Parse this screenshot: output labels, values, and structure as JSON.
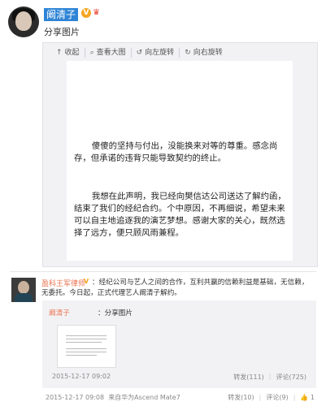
{
  "header": {
    "username": "阚清子",
    "share_text": "分享图片"
  },
  "viewer": {
    "toolbar": [
      {
        "icon": "arrow-up-icon",
        "label": "收起"
      },
      {
        "icon": "magnifier-icon",
        "label": "查看大图"
      },
      {
        "icon": "rotate-left-icon",
        "label": "向左旋转"
      },
      {
        "icon": "rotate-right-icon",
        "label": "向右旋转"
      }
    ],
    "paragraph1": "傻傻的坚持与付出，没能换来对等的尊重。感念尚存，但承诺的违背只能导致契约的终止。",
    "paragraph2": "我想在此声明，我已经向樊信达公司送达了解约函，结束了我们的经纪合约。个中原因，不再细说，希望未来可以自主地追逐我的演艺梦想。感谢大家的关心，既然选择了远方，便只顾风雨兼程。"
  },
  "comment": {
    "author": "盈科王军律师",
    "text": "：经纪公司与艺人之间的合作，互利共赢的信赖利益是基础，无信赖，无委托。今日起，正式代理艺人阚清子解约。"
  },
  "forwarded": {
    "author": "阚清子",
    "text": "：分享图片",
    "time": "2015-12-17 09:02",
    "repost": "转发(111)",
    "comments": "评论(725)"
  },
  "footer": {
    "time": "2015-12-17 09:08",
    "source": "来自华为Ascend Mate7",
    "repost": "转发(10)",
    "comments": "评论(9)",
    "likes": "1"
  },
  "colors": {
    "link": "#eb7350",
    "highlight": "#2e84d6",
    "viewer_bg": "#f2f2f5"
  }
}
